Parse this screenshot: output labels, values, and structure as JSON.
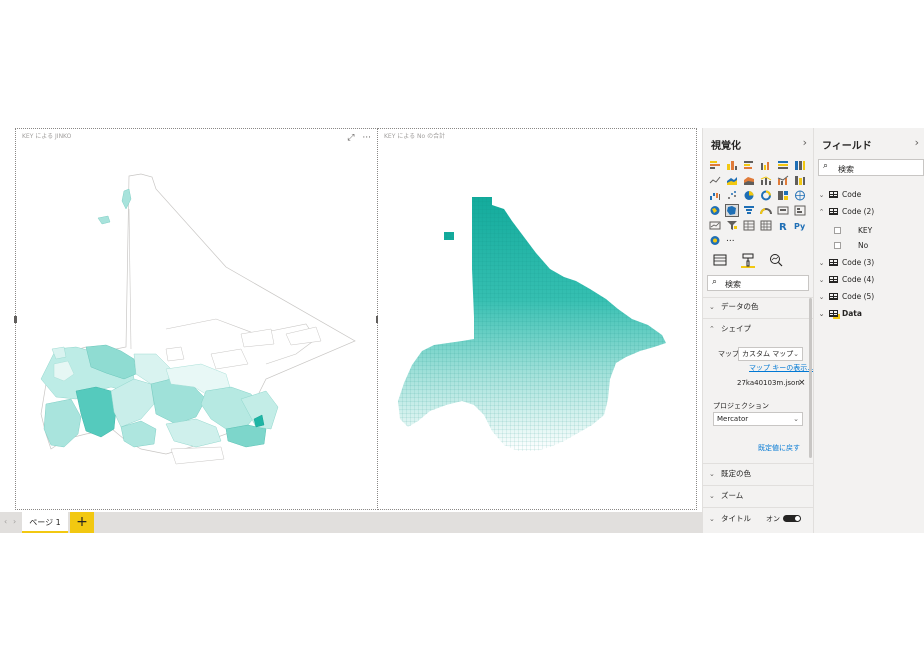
{
  "visuals": {
    "left_title": "KEY による JINKO",
    "right_title": "KEY による No の合計"
  },
  "pages": {
    "tab_label": "ページ 1",
    "add_label": "+"
  },
  "viz_pane": {
    "title": "視覚化",
    "collapse_icon": "chevron-right-icon",
    "more": "...",
    "search_placeholder": "検索",
    "sections": {
      "data_colors": "データの色",
      "shape": "シェイプ",
      "map_label": "マップ",
      "map_value": "カスタム マップ",
      "map_keys_link": "マップ キーの表示...",
      "file_name": "27ka40103m.json",
      "projection_label": "プロジェクション",
      "projection_value": "Mercator",
      "reset_link": "既定値に戻す",
      "default_color": "既定の色",
      "zoom": "ズーム",
      "title": "タイトル",
      "title_toggle": "オン"
    }
  },
  "fields_pane": {
    "title": "フィールド",
    "search_placeholder": "検索",
    "tables": [
      {
        "name": "Code",
        "expanded": false
      },
      {
        "name": "Code (2)",
        "expanded": true,
        "fields": [
          "KEY",
          "No"
        ]
      },
      {
        "name": "Code (3)",
        "expanded": false
      },
      {
        "name": "Code (4)",
        "expanded": false
      },
      {
        "name": "Code (5)",
        "expanded": false
      },
      {
        "name": "Data",
        "expanded": false
      }
    ]
  },
  "colors": {
    "accent": "#f2c811",
    "map_teal": "#1fb5a5",
    "map_light": "#c9eeea",
    "link_blue": "#0078d4"
  }
}
